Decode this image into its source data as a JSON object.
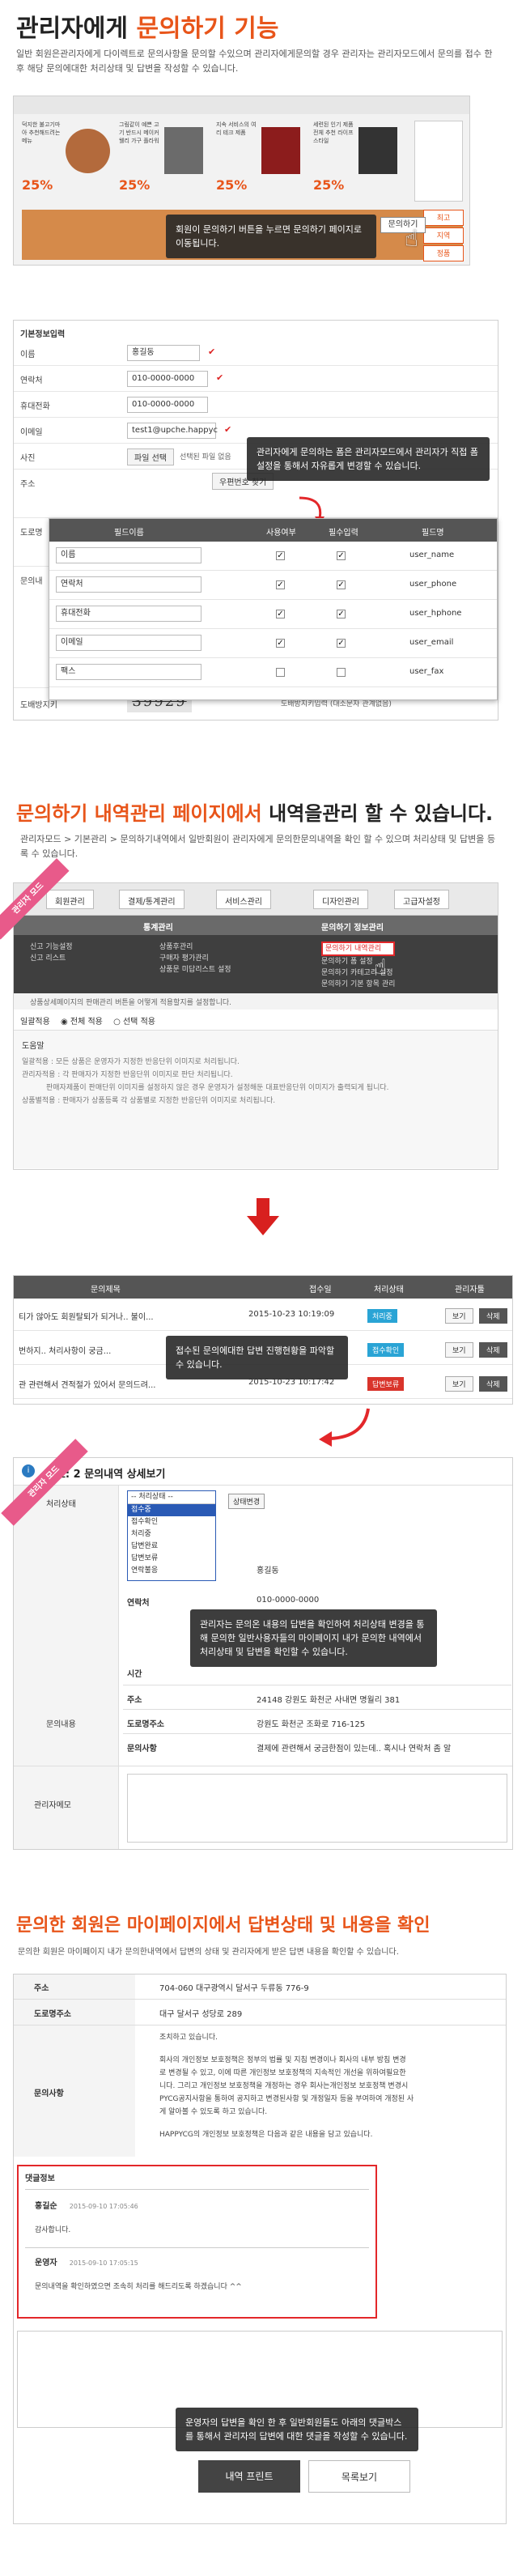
{
  "section1": {
    "title_prefix": "관리자에게 ",
    "title_accent": "문의하기 기능",
    "desc": "일반 회원은관리자에게 다이렉트로 문의사항을 문의할 수있으며 관리자에게문의할 경우 관리자는 관리자모드에서 문의를 접수 한 후 해당 문의에대한 처리상태 및 답변을 작성할 수 있습니다.",
    "products": [
      {
        "title": "덕지한 불고기마아 추천해드려는 메뉴",
        "discount": "25%",
        "color": "#b36a3c"
      },
      {
        "title": "그림같이 예쁜 고기 반드시 메이커 웰리 가구 플라워",
        "discount": "25%",
        "color": "#6b6b6b"
      },
      {
        "title": "지속 서비스의 여리 테크 제품",
        "discount": "25%",
        "color": "#8c1c1c"
      },
      {
        "title": "세련된 인기 제품 전체 추천 라이프스타일",
        "discount": "25%",
        "color": "#333333"
      }
    ],
    "tooltip": "회원이 문의하기 버튼을 누르면 문의하기 페이지로 이동됩니다.",
    "inquiry_button": "문의하기",
    "side_badges": [
      "최고",
      "지역",
      "정품"
    ]
  },
  "form": {
    "header": "기본정보입력",
    "rows": [
      {
        "label": "이름",
        "value": "홍길동"
      },
      {
        "label": "연락처",
        "value": "010-0000-0000"
      },
      {
        "label": "휴대전화",
        "value": "010-0000-0000"
      },
      {
        "label": "이메일",
        "value": "test1@upche.happyc"
      },
      {
        "label": "사진",
        "value": "파일 선택"
      },
      {
        "label": "주소",
        "value": "우편번호 찾기"
      },
      {
        "label": "도로명",
        "value": ""
      },
      {
        "label": "문의내",
        "value": ""
      },
      {
        "label": "도배방지키",
        "value": "39929"
      }
    ],
    "file_note": "선택된 파일 없음",
    "captcha_note": "도배방지키입력 (대소문자 관계없음)",
    "tooltip": "관리자에게 문의하는 폼은 관리자모드에서 관리자가 직접 폼설정을 통해서 자유롭게 변경할 수 있습니다.",
    "field_table": {
      "headers": [
        "필드이름",
        "사용여부",
        "필수입력",
        "필드명"
      ],
      "rows": [
        {
          "name": "이름",
          "use": true,
          "required": true,
          "field": "user_name"
        },
        {
          "name": "연락처",
          "use": true,
          "required": true,
          "field": "user_phone"
        },
        {
          "name": "휴대전화",
          "use": true,
          "required": true,
          "field": "user_hphone"
        },
        {
          "name": "이메일",
          "use": true,
          "required": true,
          "field": "user_email"
        },
        {
          "name": "팩스",
          "use": false,
          "required": false,
          "field": "user_fax"
        }
      ]
    }
  },
  "section2": {
    "title_accent": "문의하기 내역관리 페이지에서 ",
    "title_dark": "내역을관리 할 수 있습니다.",
    "desc": "관리자모드 > 기본관리 > 문의하기내역에서 일반회원이 관리자에게 문의한문의내역을 확인 할 수 있으며 처리상태 및 답변을 등록 수 있습니다.",
    "ribbon": "관리자 모드",
    "tabs": [
      "회원관리",
      "결제/통계관리",
      "서비스관리",
      "디자인관리",
      "고급자설정"
    ],
    "col_headers": [
      "통계관리",
      "문의하기 정보관리"
    ],
    "left_items": [
      "신고 기능설정",
      "신고 리스트"
    ],
    "mid_items": [
      "상품후관리",
      "구매자 평가관리",
      "상품문 미답리스트 설정"
    ],
    "right_items": [
      "문의하기 내역관리",
      "문의하기 폼 설정",
      "문의하기 카테고리 설정",
      "문의하기 기본 항목 관리"
    ],
    "note": "상품상세페이지의 판매관리 버튼을 어떻게 적용할지를 설정합니다.",
    "radio_label": "일괄적용",
    "radio_opts": [
      "전체 적용",
      "선택 적용"
    ],
    "help_title": "도움말",
    "help_lines": [
      "일괄적용 : 모든 상품은 운영자가 지정한 반응단위 이미지로 처리됩니다.",
      "관리자적용 : 각 판매자가 지정한 반응단위 이미지로 판단 처리됩니다.",
      "판매자제품이 판매단위 이미지를 설정하지 않은 경우 운영자가 설정해둔 대표반응단위 이미지가 출력되게 됩니다.",
      "상품별적용 : 판매자가 상품등록 각 상품별로 지정한 반응단위 이미지로 처리됩니다."
    ]
  },
  "list": {
    "headers": [
      "문의제목",
      "접수일",
      "처리상태",
      "관리자툴"
    ],
    "rows": [
      {
        "title": "티가 않아도 회원탈퇴가 되거나.. 불이...",
        "date": "2015-10-23 10:19:09",
        "status": "처리중",
        "color": "#2aa4d5"
      },
      {
        "title": "번하지.. 처리사항이 궁금...",
        "date": "2015-10-23 10:17:...",
        "status": "접수확인",
        "color": "#2aa4d5"
      },
      {
        "title": "관 관련해서 견적절가 있어서 문의드려...",
        "date": "2015-10-23 10:17:42",
        "status": "답변보류",
        "color": "#d9342b"
      }
    ],
    "btn_view": "보기",
    "btn_delete": "삭제",
    "tooltip": "접수된 문의에대한 답변 진행현황을 파악할 수 있습니다."
  },
  "detail": {
    "title": "번호: 2 문의내역 상세보기",
    "ribbon": "관리자 모드",
    "status_label": "처리상태",
    "status_select": "-- 처리상태 --",
    "status_options": [
      "-- 처리상태 --",
      "접수중",
      "접수확인",
      "처리중",
      "답변완료",
      "답변보류",
      "연락불응"
    ],
    "status_button": "상태변경",
    "inquiry_label": "문의내용",
    "name": "홍길동",
    "phone_label": "연락처",
    "phone": "010-0000-0000",
    "time_label": "시간",
    "addr_label": "주소",
    "addr": "24148 강원도 화천군 사내면 명월리 381",
    "road_label": "도로명주소",
    "road": "강원도 화천군 조화로 716-125",
    "content_label": "문의사항",
    "content": "결제에 관련해서 궁금한점이 있는데.. 혹시나 연락처 좀 알",
    "memo_label": "관리자메모",
    "tooltip": "관리자는 문의온 내용의 답변을 확인하여 처리상태 변경을 통해 문의한 일반사용자들의 마이페이지 내가 문의한 내역에서 처리상태 및 답변을 확인할 수 있습니다."
  },
  "section3": {
    "title_accent": "문의한 회원은 ",
    "title_dark": "마이페이지에서 답변상태 및 내용을 확인",
    "desc": "문의한 회원은 마이페이지 내가 문의한내역에서 답변의 상태 및 관리자에게 받은 답변 내용을 확인할 수 있습니다.",
    "rows": [
      {
        "label": "주소",
        "value": "704-060 대구광역시 달서구 두류동 776-9"
      },
      {
        "label": "도로명주소",
        "value": "대구 달서구 성당로 289"
      }
    ],
    "content_label": "문의사항",
    "content_lines": [
      "조치하고 있습니다.",
      "회사의 개인정보 보호정책은 정부의 법률 및 지침 변경이나 회사의 내부 방침 변경",
      "로 변경될 수 있고, 이에 따른 개인정보 보호정책의 지속적인 개선을 위하여필요한",
      "니다. 그리고 개인정보 보호정책을 개정하는 경우 회사는개인정보 보호정책 변경시",
      "PYCG공지사항을 통하여 공지하고 변경된사항 및 개정일자 등을 부여하여 개정된 사",
      "게 알아볼 수 있도록 하고 있습니다.",
      "HAPPYCG의 개인정보 보호정책은 다음과 같은 내용을 담고 있습니다."
    ],
    "comment_header": "댓글정보",
    "comments": [
      {
        "author": "홍길순",
        "date": "2015-09-10 17:05:46",
        "text": "감사합니다."
      },
      {
        "author": "운영자",
        "date": "2015-09-10 17:05:15",
        "text": "문의내역을 확인하였으면 조속히 처리를 해드리도록 하겠습니다 ^^"
      }
    ],
    "tooltip": "운영자의 답변을 확인 한 후 일반회원들도 아래의 댓글박스를 통해서 관리자의 답변에 대한 댓글을 작성할 수 있습니다.",
    "print_button": "내역 프린트",
    "list_button": "목록보기"
  }
}
